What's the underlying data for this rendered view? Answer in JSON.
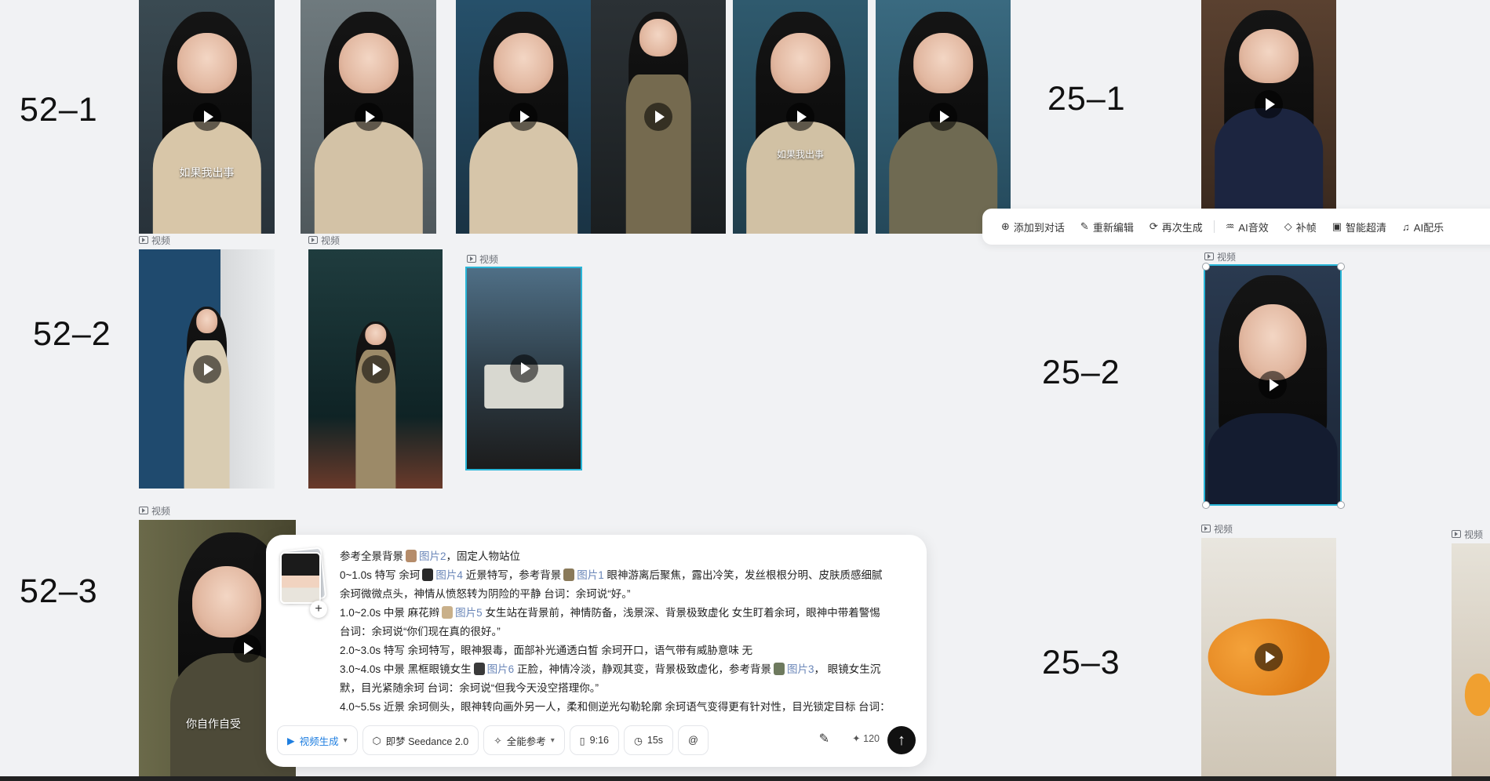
{
  "rows": [
    {
      "label": "52–1"
    },
    {
      "label": "52–2"
    },
    {
      "label": "52–3"
    },
    {
      "label": "25–1"
    },
    {
      "label": "25–2"
    },
    {
      "label": "25–3"
    }
  ],
  "video_tag": "视频",
  "subtitles": {
    "s1": "如果我出事",
    "s2": "如果我出事",
    "s3": "你自作自受"
  },
  "action_bar": {
    "add_to_chat": "添加到对话",
    "re_edit": "重新编辑",
    "regenerate": "再次生成",
    "ai_sfx": "AI音效",
    "frame_fill": "补帧",
    "upscale": "智能超清",
    "ai_music": "AI配乐"
  },
  "prompt": {
    "lines": [
      {
        "pre": "参考全景背景",
        "ref": "图片2",
        "post": "，固定人物站位"
      },
      {
        "pre": "0~1.0s 特写 余珂",
        "ref": "图片4",
        "post": "近景特写，参考背景",
        "ref2": "图片1",
        "post2": "眼神游离后聚焦，露出冷笑，发丝根根分明、皮肤质感细腻"
      },
      {
        "pre": "余珂微微点头，神情从愤怒转为阴险的平静 台词：余珂说“好。”"
      },
      {
        "pre": "1.0~2.0s 中景 麻花辫",
        "ref": "图片5",
        "post": "女生站在背景前，神情防备，浅景深、背景极致虚化 女生盯着余珂，眼神中带着警惕"
      },
      {
        "pre": "台词：余珂说“你们现在真的很好。”"
      },
      {
        "pre": "2.0~3.0s 特写 余珂特写，眼神狠毒，面部补光通透白皙 余珂开口，语气带有威胁意味 无"
      },
      {
        "pre": "3.0~4.0s 中景 黑框眼镜女生",
        "ref": "图片6",
        "post": "正脸，神情冷淡，静观其变，背景极致虚化，参考背景",
        "ref2": "图片3",
        "post2": "， 眼镜女生沉"
      },
      {
        "pre": "默，目光紧随余珂 台词：余珂说“但我今天没空搭理你。”"
      },
      {
        "pre": "4.0~5.5s 近景 余珂侧头，眼神转向画外另一人，柔和侧逆光勾勒轮廓 余珂语气变得更有针对性，目光锁定目标 台词："
      }
    ]
  },
  "toolbar": {
    "mode": "视频生成",
    "model": "即梦 Seedance 2.0",
    "reference": "全能参考",
    "ratio": "9:16",
    "duration": "15s",
    "mention": "@",
    "credits": "120"
  },
  "colors": {
    "accent": "#1e7ee0",
    "selection": "#29b6d8"
  }
}
